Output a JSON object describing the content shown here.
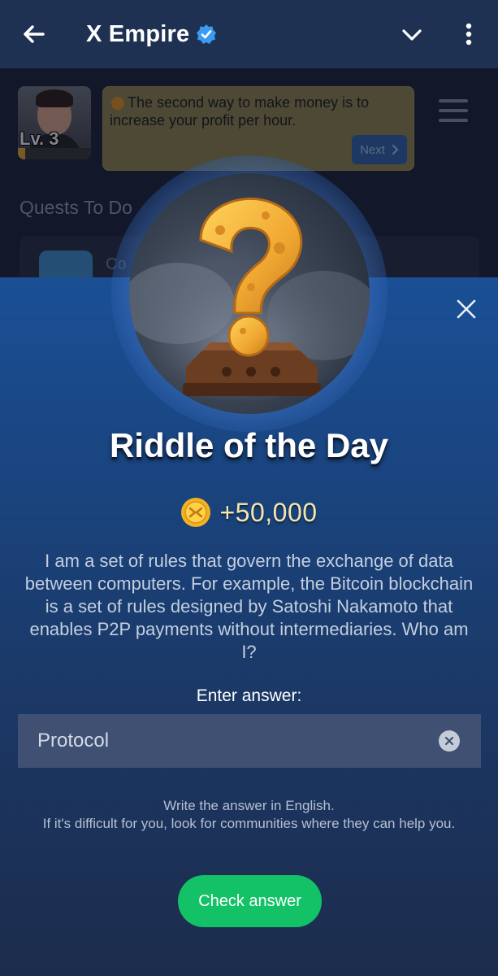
{
  "header": {
    "title": "X Empire",
    "back_icon": "arrow-left-icon",
    "verified_icon": "verified-badge-icon",
    "chevron_icon": "chevron-down-icon",
    "more_icon": "more-vertical-icon"
  },
  "background": {
    "level_label": "Lv. 3",
    "level_progress": 0.1,
    "tip": {
      "text": "The second way to make money is to increase your profit per hour.",
      "next_label": "Next"
    },
    "quests_heading": "Quests To Do",
    "quest_title": "Co"
  },
  "modal": {
    "title": "Riddle of the Day",
    "reward": "+50,000",
    "riddle": "I am a set of rules that govern the exchange of data between computers. For example, the Bitcoin blockchain is a set of rules designed by Satoshi Nakamoto that enables P2P payments without intermediaries. Who am I?",
    "answer_label": "Enter answer:",
    "answer_value": "Protocol",
    "hint_line1": "Write the answer in English.",
    "hint_line2": "If it's difficult for you, look for communities where they can help you.",
    "check_button": "Check answer"
  },
  "colors": {
    "header_bg": "#1f3152",
    "modal_top": "#1a4f95",
    "modal_bottom": "#1c2c4c",
    "input_bg": "#3f5073",
    "accent_green": "#13c266",
    "verified_blue": "#3b9bf0",
    "reward_text": "#f3e7b0"
  }
}
